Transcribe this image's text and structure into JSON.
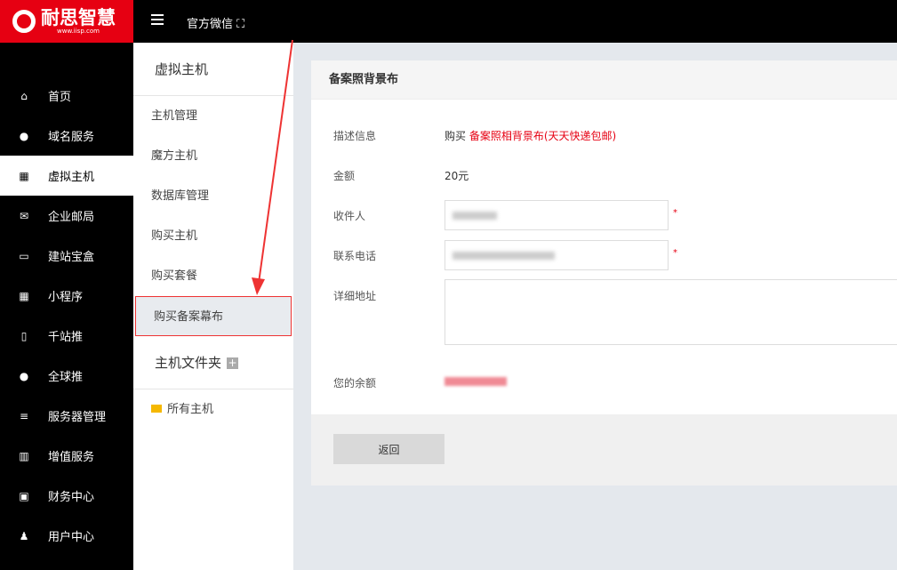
{
  "brand": {
    "name": "耐思智慧",
    "url": "www.iisp.com"
  },
  "topbar": {
    "wechat": "官方微信"
  },
  "sidebar": {
    "items": [
      {
        "label": "首页",
        "icon": "home-icon"
      },
      {
        "label": "域名服务",
        "icon": "globe-icon"
      },
      {
        "label": "虚拟主机",
        "icon": "windows-icon"
      },
      {
        "label": "企业邮局",
        "icon": "mail-icon"
      },
      {
        "label": "建站宝盒",
        "icon": "monitor-icon"
      },
      {
        "label": "小程序",
        "icon": "grid-icon"
      },
      {
        "label": "千站推",
        "icon": "doc-icon"
      },
      {
        "label": "全球推",
        "icon": "globe-icon"
      },
      {
        "label": "服务器管理",
        "icon": "server-icon"
      },
      {
        "label": "增值服务",
        "icon": "chart-icon"
      },
      {
        "label": "财务中心",
        "icon": "money-icon"
      },
      {
        "label": "用户中心",
        "icon": "user-icon"
      }
    ],
    "active": "虚拟主机"
  },
  "submenu": {
    "title": "虚拟主机",
    "items": [
      "主机管理",
      "魔方主机",
      "数据库管理",
      "购买主机",
      "购买套餐",
      "购买备案幕布"
    ],
    "folder_title": "主机文件夹",
    "folders": [
      "所有主机"
    ]
  },
  "form": {
    "title": "备案照背景布",
    "desc_label": "描述信息",
    "desc_prefix": "购买",
    "desc_value": "备案照相背景布(天天快递包邮)",
    "amount_label": "金额",
    "amount": "20元",
    "recipient_label": "收件人",
    "phone_label": "联系电话",
    "address_label": "详细地址",
    "balance_label": "您的余额",
    "required": "*",
    "back": "返回"
  }
}
